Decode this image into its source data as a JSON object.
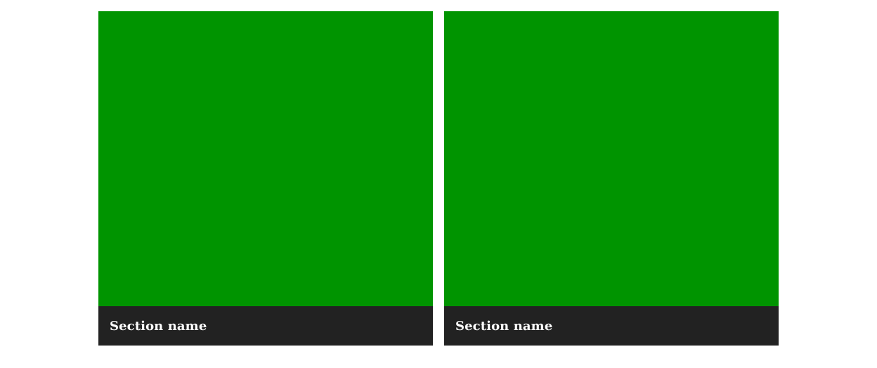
{
  "colors": {
    "image_placeholder": "#009400",
    "footer_background": "#222222",
    "footer_text": "#ffffff",
    "page_background": "#ffffff"
  },
  "cards": [
    {
      "title": "Section name"
    },
    {
      "title": "Section name"
    }
  ]
}
